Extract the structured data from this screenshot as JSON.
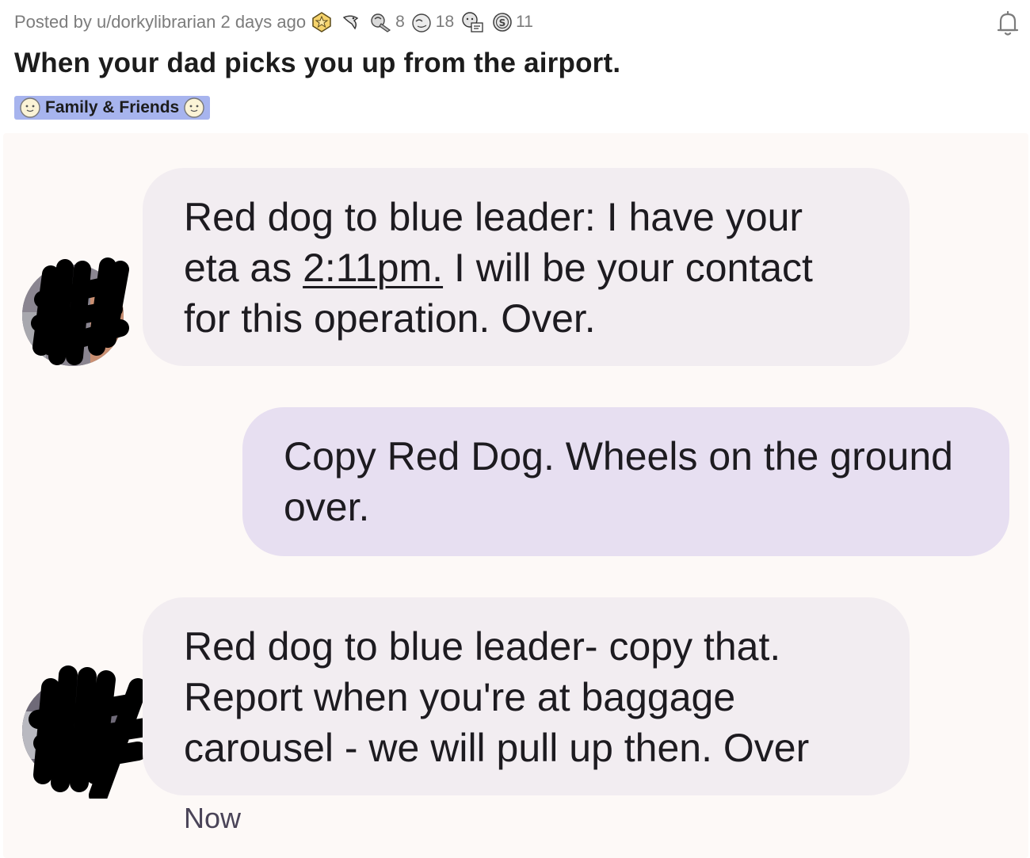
{
  "post": {
    "meta_text": "Posted by u/dorkylibrarian 2 days ago",
    "awards": [
      {
        "name": "gold-award-icon",
        "count": ""
      },
      {
        "name": "bird-award-icon",
        "count": ""
      },
      {
        "name": "silver-award-icon",
        "count": "8"
      },
      {
        "name": "faceplant-award-icon",
        "count": "18"
      },
      {
        "name": "helpful-award-icon",
        "count": ""
      },
      {
        "name": "coin-award-icon",
        "count": "11"
      }
    ],
    "title": "When your dad picks you up from the airport.",
    "flair": "Family & Friends"
  },
  "conversation": {
    "messages": [
      {
        "direction": "incoming",
        "line1": "Red dog to blue leader:  I have your",
        "line2_pre": "eta as ",
        "line2_link": "2:11pm.",
        "line2_post": " I will be your contact",
        "line3": "for this operation. Over."
      },
      {
        "direction": "outgoing",
        "line1": "Copy Red Dog. Wheels on the ground",
        "line2": "over."
      },
      {
        "direction": "incoming",
        "line1": "Red dog to blue leader- copy that.",
        "line2": "Report when you're at baggage",
        "line3": "carousel - we will pull up then. Over"
      }
    ],
    "timestamp": "Now"
  },
  "colors": {
    "incoming_bubble": "#f2edf1",
    "outgoing_bubble": "#e7dff1",
    "flair_bg": "#a7b4ee",
    "screenshot_bg": "#fdf9f7"
  }
}
